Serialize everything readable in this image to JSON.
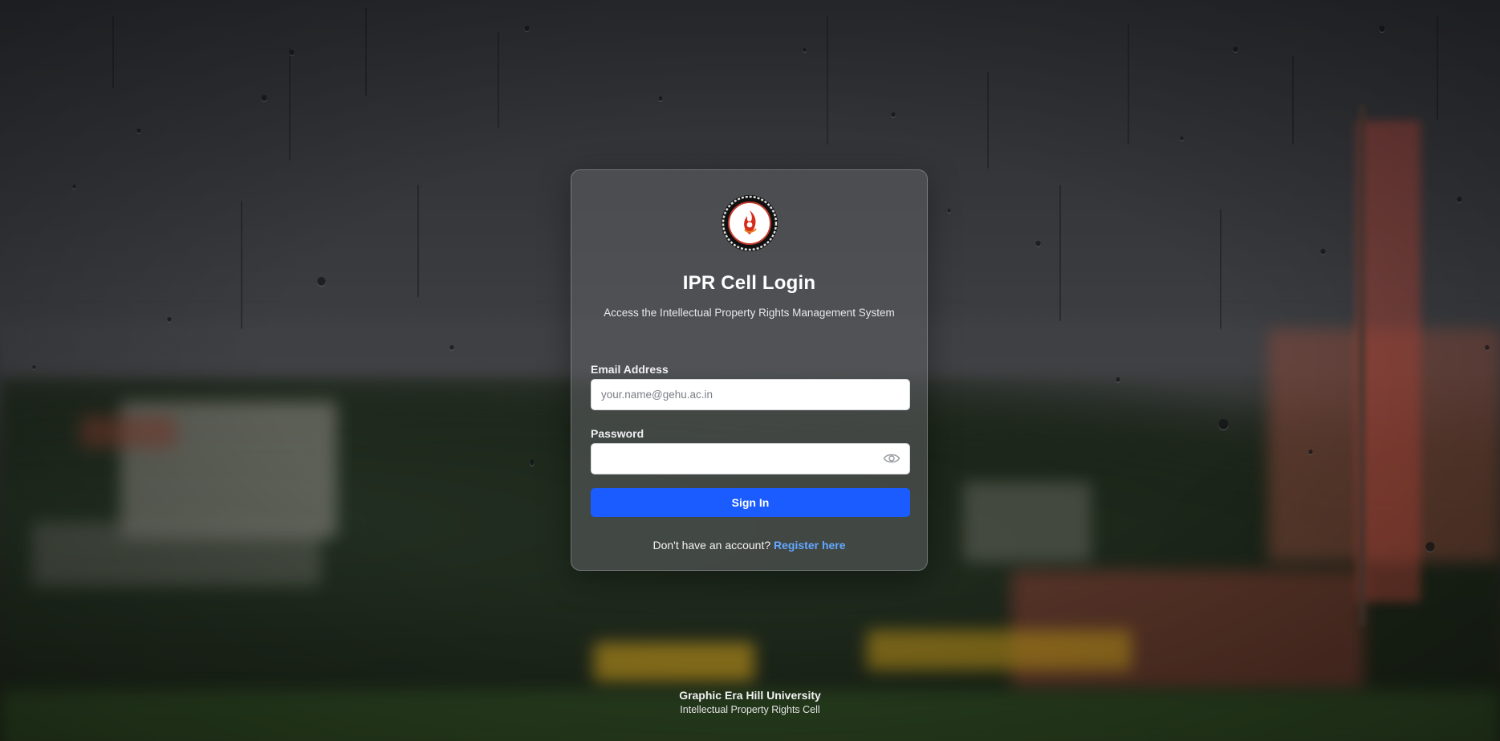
{
  "login": {
    "title": "IPR Cell Login",
    "subtitle": "Access the Intellectual Property Rights Management System",
    "email_label": "Email Address",
    "email_placeholder": "your.name@gehu.ac.in",
    "email_value": "",
    "password_label": "Password",
    "password_value": "",
    "password_toggle_icon": "eye-icon",
    "signin_label": "Sign In",
    "register_prompt": "Don't have an account?",
    "register_link": "Register here",
    "logo_icon": "university-seal-logo"
  },
  "footer": {
    "university": "Graphic Era Hill University",
    "cell": "Intellectual Property Rights Cell"
  },
  "colors": {
    "primary_button": "#1a5cff",
    "link": "#63a8ff",
    "card_background": "rgba(95,96,100,0.55)"
  }
}
